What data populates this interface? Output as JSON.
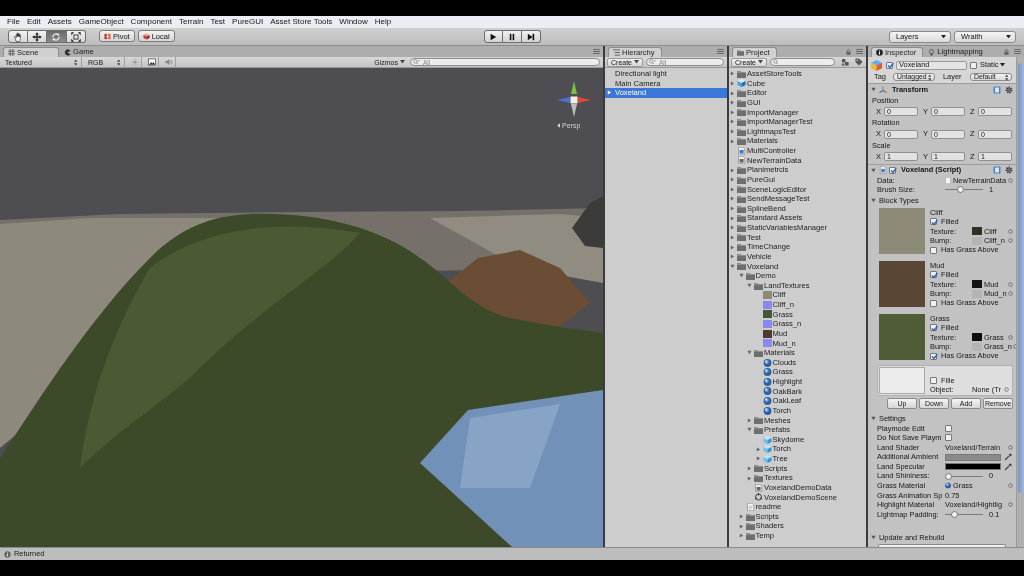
{
  "menu_bar": [
    "File",
    "Edit",
    "Assets",
    "GameObject",
    "Component",
    "Terrain",
    "Test",
    "PureGUI",
    "Asset Store Tools",
    "Window",
    "Help"
  ],
  "toolbar": {
    "tools": [
      {
        "kind": "hand",
        "selected": false
      },
      {
        "kind": "move",
        "selected": false
      },
      {
        "kind": "rotate",
        "selected": true
      },
      {
        "kind": "scale",
        "selected": false
      }
    ],
    "pivot": "Pivot",
    "local": "Local",
    "playback": [
      {
        "kind": "play"
      },
      {
        "kind": "pause"
      },
      {
        "kind": "step"
      }
    ],
    "layers": "Layers",
    "layout": "Wraith"
  },
  "scene": {
    "tabs": [
      {
        "label": "Scene",
        "kind": "scene",
        "selected": true
      },
      {
        "label": "Game",
        "kind": "game",
        "selected": false
      }
    ],
    "render_mode": "Textured",
    "channel": "RGB",
    "toggles": [
      {
        "kind": "lighting"
      },
      {
        "kind": "skybox"
      },
      {
        "kind": "audio"
      }
    ],
    "gizmos": "Gizmos",
    "search_placeholder": "All",
    "projection": "Persp"
  },
  "hierarchy": {
    "title": "Hierarchy",
    "create": "Create",
    "search_placeholder": "All",
    "items": [
      {
        "label": "Directional light",
        "selected": false
      },
      {
        "label": "Main Camera",
        "selected": false
      },
      {
        "label": "Voxeland",
        "selected": true,
        "expanded": false
      }
    ]
  },
  "project": {
    "title": "Project",
    "create": "Create",
    "tree": [
      {
        "label": "AssetStoreTools",
        "kind": "folder",
        "expanded": false
      },
      {
        "label": "Cube",
        "kind": "model",
        "expanded": false
      },
      {
        "label": "Editor",
        "kind": "folder",
        "expanded": false
      },
      {
        "label": "GUI",
        "kind": "folder",
        "expanded": false
      },
      {
        "label": "ImportManager",
        "kind": "folder",
        "expanded": false
      },
      {
        "label": "ImportManagerTest",
        "kind": "folder",
        "expanded": false
      },
      {
        "label": "LightmapsTest",
        "kind": "folder",
        "expanded": false
      },
      {
        "label": "Materials",
        "kind": "folder",
        "expanded": false
      },
      {
        "label": "MultiController",
        "kind": "script"
      },
      {
        "label": "NewTerrainData",
        "kind": "data"
      },
      {
        "label": "Planimetrcis",
        "kind": "folder",
        "expanded": false
      },
      {
        "label": "PureGui",
        "kind": "folder",
        "expanded": false
      },
      {
        "label": "SceneLogicEditor",
        "kind": "folder",
        "expanded": false
      },
      {
        "label": "SendMessageTest",
        "kind": "folder",
        "expanded": false
      },
      {
        "label": "SplineBend",
        "kind": "folder",
        "expanded": false
      },
      {
        "label": "Standard Assets",
        "kind": "folder",
        "expanded": false
      },
      {
        "label": "StaticVariablesManager",
        "kind": "folder",
        "expanded": false
      },
      {
        "label": "Test",
        "kind": "folder",
        "expanded": false
      },
      {
        "label": "TimeChange",
        "kind": "folder",
        "expanded": false
      },
      {
        "label": "Vehicle",
        "kind": "folder",
        "expanded": false
      },
      {
        "label": "Voxeland",
        "kind": "folder",
        "expanded": true,
        "children": [
          {
            "label": "Demo",
            "kind": "folder",
            "expanded": true,
            "children": [
              {
                "label": "LandTextures",
                "kind": "folder",
                "expanded": true,
                "children": [
                  {
                    "label": "Cliff",
                    "kind": "texture",
                    "color": "#8c8977"
                  },
                  {
                    "label": "Cliff_n",
                    "kind": "texture",
                    "color": "#8a86f2"
                  },
                  {
                    "label": "Grass",
                    "kind": "texture",
                    "color": "#4a5430"
                  },
                  {
                    "label": "Grass_n",
                    "kind": "texture",
                    "color": "#8a86f2"
                  },
                  {
                    "label": "Mud",
                    "kind": "texture",
                    "color": "#4d3a29"
                  },
                  {
                    "label": "Mud_n",
                    "kind": "texture",
                    "color": "#8a86f2"
                  }
                ]
              },
              {
                "label": "Materials",
                "kind": "folder",
                "expanded": true,
                "children": [
                  {
                    "label": "Clouds",
                    "kind": "material"
                  },
                  {
                    "label": "Grass",
                    "kind": "material"
                  },
                  {
                    "label": "Highlight",
                    "kind": "material"
                  },
                  {
                    "label": "OakBark",
                    "kind": "material"
                  },
                  {
                    "label": "OakLeaf",
                    "kind": "material"
                  },
                  {
                    "label": "Torch",
                    "kind": "material"
                  }
                ]
              },
              {
                "label": "Meshes",
                "kind": "folder",
                "expanded": false
              },
              {
                "label": "Prefabs",
                "kind": "folder",
                "expanded": true,
                "children": [
                  {
                    "label": "Skydome",
                    "kind": "prefab"
                  },
                  {
                    "label": "Torch",
                    "kind": "prefab",
                    "expanded": false
                  },
                  {
                    "label": "Tree",
                    "kind": "prefab",
                    "expanded": false
                  }
                ]
              },
              {
                "label": "Scripts",
                "kind": "folder",
                "expanded": false
              },
              {
                "label": "Textures",
                "kind": "folder",
                "expanded": false
              },
              {
                "label": "VoxelandDemoData",
                "kind": "data"
              },
              {
                "label": "VoxelandDemoScene",
                "kind": "scene"
              }
            ]
          },
          {
            "label": "readme",
            "kind": "text"
          },
          {
            "label": "Scripts",
            "kind": "folder",
            "expanded": false
          },
          {
            "label": "Shaders",
            "kind": "folder",
            "expanded": false
          },
          {
            "label": "Temp",
            "kind": "folder",
            "expanded": false
          }
        ]
      }
    ]
  },
  "inspector": {
    "tabs": [
      {
        "label": "Inspector",
        "kind": "inspector",
        "selected": true
      },
      {
        "label": "Lightmapping",
        "kind": "lightmapping",
        "selected": false
      }
    ],
    "object": {
      "active": true,
      "name": "Voxeland",
      "static": false,
      "static_label": "Static",
      "tag_label": "Tag",
      "tag": "Untagged",
      "layer_label": "Layer",
      "layer": "Default"
    },
    "transform": {
      "title": "Transform",
      "expanded": true,
      "rows": [
        {
          "label": "Position",
          "fields": [
            {
              "axis": "X",
              "value": "0"
            },
            {
              "axis": "Y",
              "value": "0"
            },
            {
              "axis": "Z",
              "value": "0"
            }
          ]
        },
        {
          "label": "Rotation",
          "fields": [
            {
              "axis": "X",
              "value": "0"
            },
            {
              "axis": "Y",
              "value": "0"
            },
            {
              "axis": "Z",
              "value": "0"
            }
          ]
        },
        {
          "label": "Scale",
          "fields": [
            {
              "axis": "X",
              "value": "1"
            },
            {
              "axis": "Y",
              "value": "1"
            },
            {
              "axis": "Z",
              "value": "1"
            }
          ]
        }
      ]
    },
    "script": {
      "title": "Voxeland (Script)",
      "enabled": true,
      "expanded": true,
      "data_label": "Data:",
      "data": "NewTerrainData",
      "brush_label": "Brush Size:",
      "brush": {
        "level": 0.4,
        "value": "1"
      },
      "block_types": {
        "title": "Block Types",
        "expanded": true,
        "blocks": [
          {
            "kind": "texture",
            "name": "Cliff",
            "color": "#8d8a78",
            "filled": true,
            "filled_label": "Filled",
            "texture_label": "Texture:",
            "texture": {
              "name": "Cliff",
              "color": "#2f3024"
            },
            "bump_label": "Bump:",
            "bump": "Cliff_n",
            "grass": false,
            "grass_label": "Has Grass Above"
          },
          {
            "kind": "texture",
            "name": "Mud",
            "color": "#5a4634",
            "filled": true,
            "filled_label": "Filled",
            "texture_label": "Texture:",
            "texture": {
              "name": "Mud",
              "color": "#161311"
            },
            "bump_label": "Bump:",
            "bump": "Mud_n",
            "grass": false,
            "grass_label": "Has Grass Above"
          },
          {
            "kind": "texture",
            "name": "Grass",
            "color": "#4f5c35",
            "filled": true,
            "filled_label": "Filled",
            "texture_label": "Texture:",
            "texture": {
              "name": "Grass",
              "color": "#0f0f0c"
            },
            "bump_label": "Bump:",
            "bump": "Grass_n",
            "grass": true,
            "grass_label": "Has Grass Above"
          },
          {
            "kind": "object",
            "filled": false,
            "filled_label": "Fille",
            "object_label": "Object:",
            "object": "None (Tr"
          }
        ],
        "buttons": [
          "Up",
          "Down",
          "Add",
          "Remove"
        ]
      }
    },
    "settings": {
      "title": "Settings",
      "expanded": true,
      "rows": [
        {
          "kind": "checkbox",
          "label": "Playmode Edit",
          "checked": false
        },
        {
          "kind": "checkbox",
          "label": "Do Not Save Playm",
          "checked": false
        },
        {
          "kind": "object",
          "label": "Land Shader",
          "value": "Voxeland/Terrain"
        },
        {
          "kind": "color",
          "label": "Additional Ambient",
          "color": "#8a8a8a"
        },
        {
          "kind": "color",
          "label": "Land Specular",
          "color": "#000000"
        },
        {
          "kind": "slider",
          "label": "Land Shininess:",
          "level": 0,
          "value": "0"
        },
        {
          "kind": "material",
          "label": "Grass Material",
          "value": "Grass"
        },
        {
          "kind": "number",
          "label": "Grass Animation Sp",
          "value": "0.75"
        },
        {
          "kind": "object",
          "label": "Highlight Material",
          "value": "Voxeland/Hightlig"
        },
        {
          "kind": "slider",
          "label": "Lightmap Padding:",
          "level": 0.2,
          "value": "0.1"
        }
      ]
    },
    "update": {
      "title": "Update and Rebuild",
      "expanded": true
    }
  },
  "status_bar": {
    "message": "Returned"
  }
}
